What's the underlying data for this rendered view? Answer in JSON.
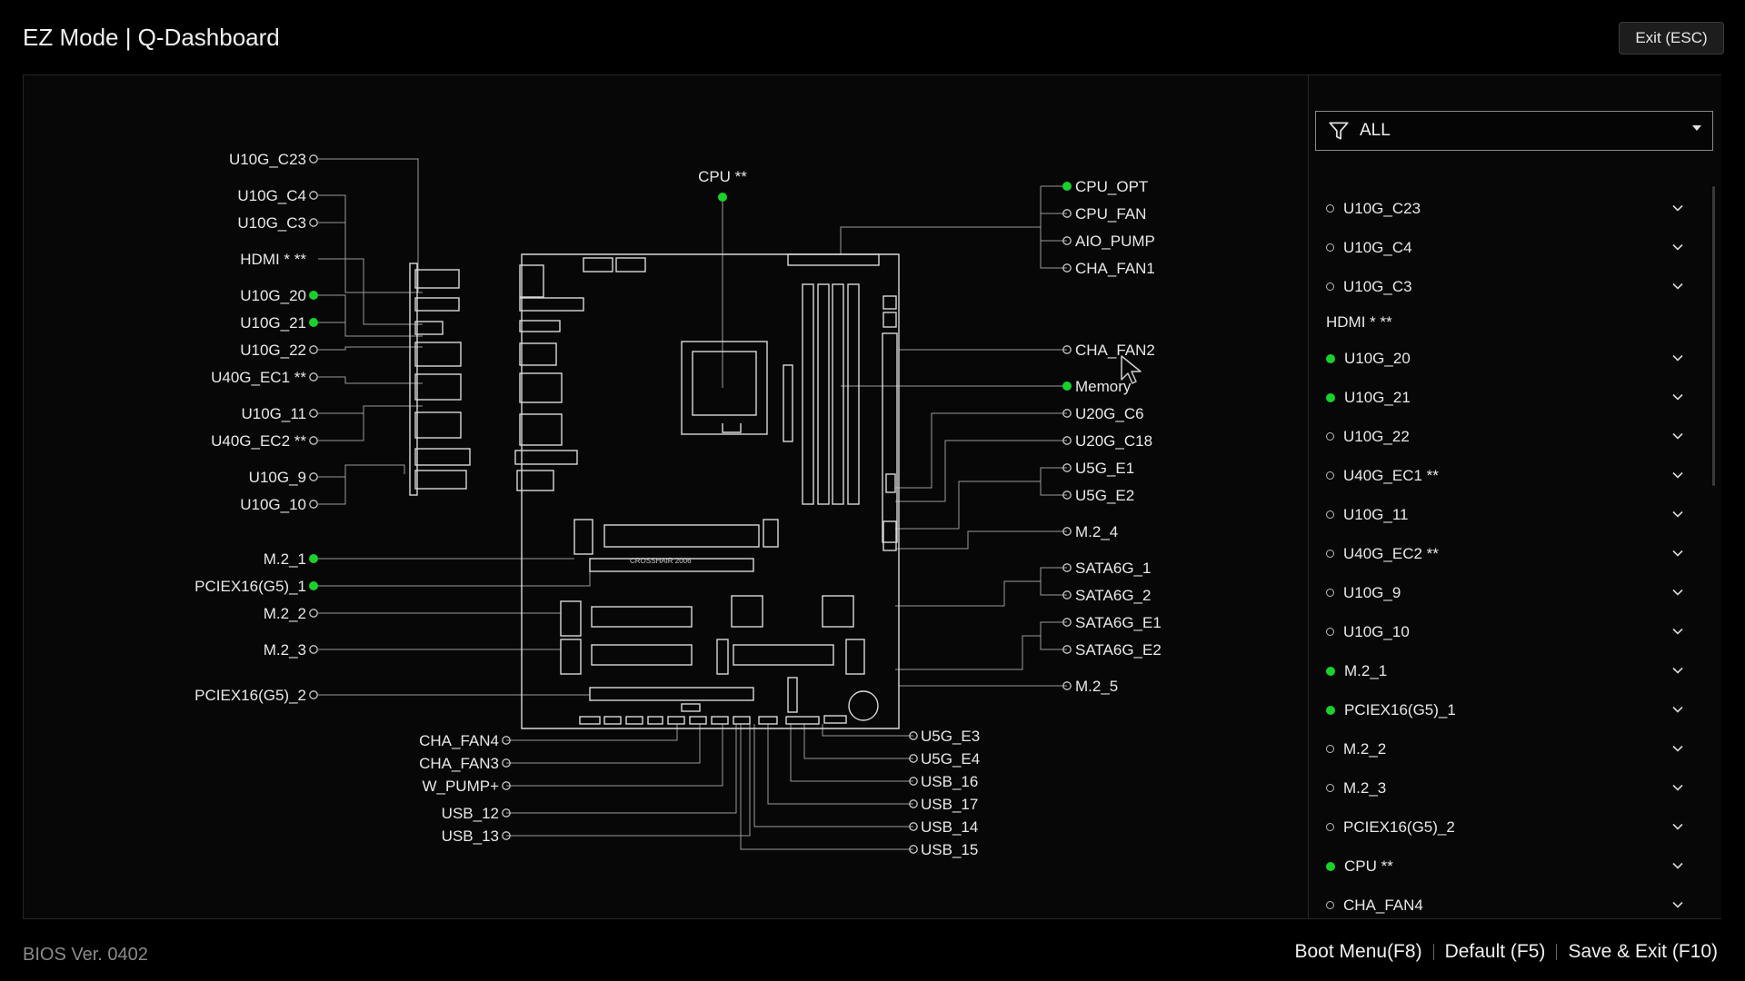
{
  "header": {
    "title": "EZ Mode | Q-Dashboard",
    "exit_label": "Exit (ESC)"
  },
  "filter": {
    "icon": "filter-icon",
    "value": "ALL"
  },
  "board_labels": {
    "left": [
      {
        "text": "U10G_C23",
        "on": false
      },
      {
        "text": "U10G_C4",
        "on": false
      },
      {
        "text": "U10G_C3",
        "on": false
      },
      {
        "text": "HDMI * **",
        "on": null
      },
      {
        "text": "U10G_20",
        "on": true
      },
      {
        "text": "U10G_21",
        "on": true
      },
      {
        "text": "U10G_22",
        "on": false
      },
      {
        "text": "U40G_EC1 **",
        "on": false
      },
      {
        "text": "U10G_11",
        "on": false
      },
      {
        "text": "U40G_EC2 **",
        "on": false
      },
      {
        "text": "U10G_9",
        "on": false
      },
      {
        "text": "U10G_10",
        "on": false
      },
      {
        "text": "M.2_1",
        "on": true
      },
      {
        "text": "PCIEX16(G5)_1",
        "on": true
      },
      {
        "text": "M.2_2",
        "on": false
      },
      {
        "text": "M.2_3",
        "on": false
      },
      {
        "text": "PCIEX16(G5)_2",
        "on": false
      }
    ],
    "top": {
      "text": "CPU **",
      "on": true
    },
    "right": [
      {
        "text": "CPU_OPT",
        "on": true
      },
      {
        "text": "CPU_FAN",
        "on": false
      },
      {
        "text": "AIO_PUMP",
        "on": false
      },
      {
        "text": "CHA_FAN1",
        "on": false
      },
      {
        "text": "CHA_FAN2",
        "on": false
      },
      {
        "text": "Memory",
        "on": true
      },
      {
        "text": "U20G_C6",
        "on": false
      },
      {
        "text": "U20G_C18",
        "on": false
      },
      {
        "text": "U5G_E1",
        "on": false
      },
      {
        "text": "U5G_E2",
        "on": false
      },
      {
        "text": "M.2_4",
        "on": false
      },
      {
        "text": "SATA6G_1",
        "on": false
      },
      {
        "text": "SATA6G_2",
        "on": false
      },
      {
        "text": "SATA6G_E1",
        "on": false
      },
      {
        "text": "SATA6G_E2",
        "on": false
      },
      {
        "text": "M.2_5",
        "on": false
      }
    ],
    "bottom_left": [
      {
        "text": "CHA_FAN4",
        "on": false
      },
      {
        "text": "CHA_FAN3",
        "on": false
      },
      {
        "text": "W_PUMP+",
        "on": false
      },
      {
        "text": "USB_12",
        "on": false
      },
      {
        "text": "USB_13",
        "on": false
      }
    ],
    "bottom_right": [
      {
        "text": "U5G_E3",
        "on": false
      },
      {
        "text": "U5G_E4",
        "on": false
      },
      {
        "text": "USB_16",
        "on": false
      },
      {
        "text": "USB_17",
        "on": false
      },
      {
        "text": "USB_14",
        "on": false
      },
      {
        "text": "USB_15",
        "on": false
      }
    ],
    "board_silk": "CROSSHAIR 2006"
  },
  "device_list": [
    {
      "name": "U10G_C23",
      "on": false,
      "expandable": true
    },
    {
      "name": "U10G_C4",
      "on": false,
      "expandable": true
    },
    {
      "name": "U10G_C3",
      "on": false,
      "expandable": true
    },
    {
      "name": "HDMI * **",
      "on": null,
      "expandable": false
    },
    {
      "name": "U10G_20",
      "on": true,
      "expandable": true
    },
    {
      "name": "U10G_21",
      "on": true,
      "expandable": true
    },
    {
      "name": "U10G_22",
      "on": false,
      "expandable": true
    },
    {
      "name": "U40G_EC1 **",
      "on": false,
      "expandable": true
    },
    {
      "name": "U10G_11",
      "on": false,
      "expandable": true
    },
    {
      "name": "U40G_EC2 **",
      "on": false,
      "expandable": true
    },
    {
      "name": "U10G_9",
      "on": false,
      "expandable": true
    },
    {
      "name": "U10G_10",
      "on": false,
      "expandable": true
    },
    {
      "name": "M.2_1",
      "on": true,
      "expandable": true
    },
    {
      "name": "PCIEX16(G5)_1",
      "on": true,
      "expandable": true
    },
    {
      "name": "M.2_2",
      "on": false,
      "expandable": true
    },
    {
      "name": "M.2_3",
      "on": false,
      "expandable": true
    },
    {
      "name": "PCIEX16(G5)_2",
      "on": false,
      "expandable": true
    },
    {
      "name": "CPU **",
      "on": true,
      "expandable": true
    },
    {
      "name": "CHA_FAN4",
      "on": false,
      "expandable": true
    }
  ],
  "footer": {
    "bios_version": "BIOS Ver. 0402",
    "boot_menu": "Boot Menu(F8)",
    "default": "Default (F5)",
    "save_exit": "Save & Exit (F10)"
  },
  "colors": {
    "active": "#19d12a",
    "line": "#9a9a9a",
    "background": "#000000"
  }
}
